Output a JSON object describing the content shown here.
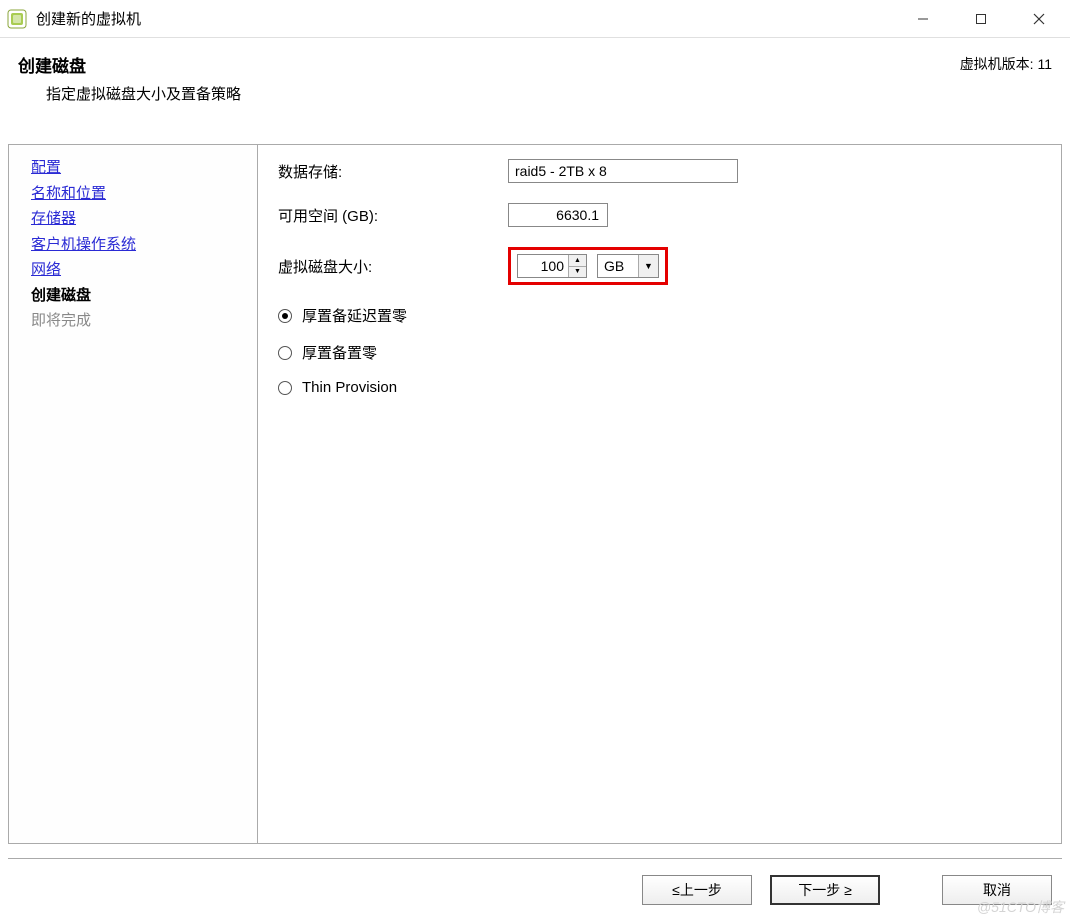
{
  "window": {
    "title": "创建新的虚拟机"
  },
  "header": {
    "title": "创建磁盘",
    "subtitle": "指定虚拟磁盘大小及置备策略",
    "version_label": "虚拟机版本: 11"
  },
  "sidebar": {
    "steps": {
      "config": "配置",
      "name_location": "名称和位置",
      "storage": "存储器",
      "guest_os": "客户机操作系统",
      "network": "网络",
      "create_disk": "创建磁盘",
      "ready": "即将完成"
    }
  },
  "form": {
    "datastore_label": "数据存储:",
    "datastore_value": "raid5 - 2TB x 8",
    "freespace_label": "可用空间 (GB):",
    "freespace_value": "6630.1",
    "disksize_label": "虚拟磁盘大小:",
    "disksize_value": "100",
    "disksize_unit": "GB",
    "provision": {
      "thick_lazy": "厚置备延迟置零",
      "thick_eager": "厚置备置零",
      "thin": "Thin Provision"
    }
  },
  "footer": {
    "back": "≤上一步",
    "next": "下一步 ≥",
    "cancel": "取消"
  },
  "watermark": "@51CTO博客"
}
